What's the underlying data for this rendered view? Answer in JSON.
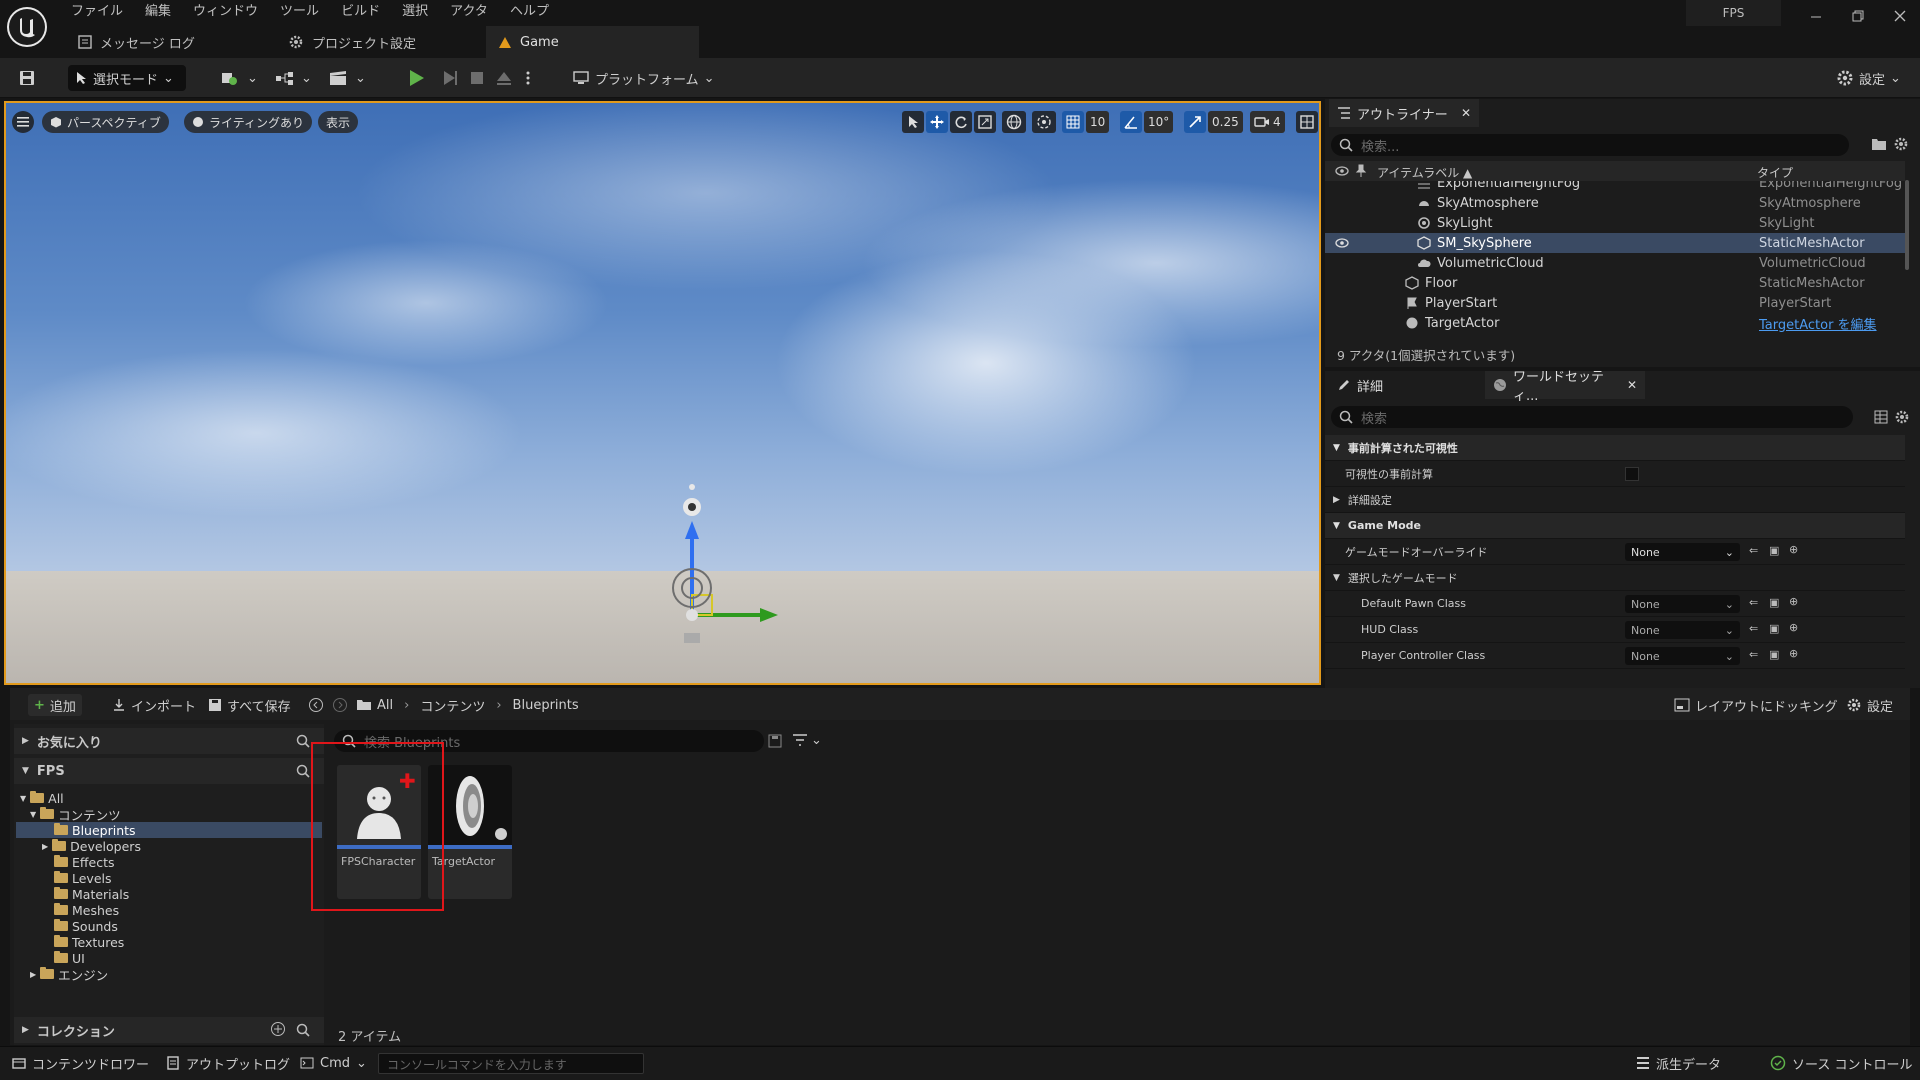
{
  "menu": [
    "ファイル",
    "編集",
    "ウィンドウ",
    "ツール",
    "ビルド",
    "選択",
    "アクタ",
    "ヘルプ"
  ],
  "window": {
    "fps_label": "FPS"
  },
  "tabs": [
    {
      "label": "メッセージ ログ",
      "icon": "message-log-icon"
    },
    {
      "label": "プロジェクト設定",
      "icon": "gear-icon"
    },
    {
      "label": "Game",
      "icon": "level-icon"
    }
  ],
  "toolbar": {
    "select_mode": "選択モード",
    "platform": "プラットフォーム",
    "settings": "設定"
  },
  "viewport": {
    "perspective": "パースペクティブ",
    "lighting": "ライティングあり",
    "show": "表示",
    "grid_snap": "10",
    "rotation_snap": "10°",
    "scale_snap": "0.25",
    "camera_speed": "4"
  },
  "outliner": {
    "tab": "アウトライナー",
    "search_placeholder": "検索...",
    "col_label": "アイテムラベル ▲",
    "col_type": "タイプ",
    "rows": [
      {
        "label": "ExponentialHeightFog",
        "type": "ExponentialHeightFog"
      },
      {
        "label": "SkyAtmosphere",
        "type": "SkyAtmosphere"
      },
      {
        "label": "SkyLight",
        "type": "SkyLight"
      },
      {
        "label": "SM_SkySphere",
        "type": "StaticMeshActor"
      },
      {
        "label": "VolumetricCloud",
        "type": "VolumetricCloud"
      },
      {
        "label": "Floor",
        "type": "StaticMeshActor"
      },
      {
        "label": "PlayerStart",
        "type": "PlayerStart"
      },
      {
        "label": "TargetActor",
        "type": "TargetActor を編集"
      }
    ],
    "footer": "9 アクタ(1個選択されています)"
  },
  "details": {
    "tab_details": "詳細",
    "tab_world": "ワールドセッティ...",
    "search_placeholder": "検索",
    "cat_precomputed": "事前計算された可視性",
    "precompute_visibility": "可視性の事前計算",
    "advanced": "詳細設定",
    "cat_game_mode": "Game Mode",
    "game_mode_override": "ゲームモードオーバーライド",
    "override_value": "None",
    "selected_game_mode": "選択したゲームモード",
    "default_pawn": "Default Pawn Class",
    "hud_class": "HUD Class",
    "player_controller": "Player Controller Class",
    "none": "None"
  },
  "content_browser": {
    "add": "追加",
    "import": "インポート",
    "save_all": "すべて保存",
    "crumbs": [
      "All",
      "コンテンツ",
      "Blueprints"
    ],
    "dock": "レイアウトにドッキング",
    "settings": "設定",
    "favorites": "お気に入り",
    "fps_root": "FPS",
    "search_placeholder": "検索 Blueprints",
    "tree": [
      {
        "label": "All",
        "depth": 0
      },
      {
        "label": "コンテンツ",
        "depth": 1
      },
      {
        "label": "Blueprints",
        "depth": 2
      },
      {
        "label": "Developers",
        "depth": 2
      },
      {
        "label": "Effects",
        "depth": 2
      },
      {
        "label": "Levels",
        "depth": 2
      },
      {
        "label": "Materials",
        "depth": 2
      },
      {
        "label": "Meshes",
        "depth": 2
      },
      {
        "label": "Sounds",
        "depth": 2
      },
      {
        "label": "Textures",
        "depth": 2
      },
      {
        "label": "UI",
        "depth": 2
      },
      {
        "label": "エンジン",
        "depth": 1
      }
    ],
    "collections": "コレクション",
    "assets": [
      {
        "name": "FPSCharacter"
      },
      {
        "name": "TargetActor"
      }
    ],
    "item_count": "2 アイテム"
  },
  "statusbar": {
    "content_drawer": "コンテンツドロワー",
    "output_log": "アウトプットログ",
    "cmd": "Cmd",
    "console_placeholder": "コンソールコマンドを入力します",
    "derived_data": "派生データ",
    "source_control": "ソース コントロール"
  },
  "colors": {
    "accent_orange": "#e29a1c",
    "selected_row": "#3a4a63",
    "play_green": "#5fb34a",
    "highlight_red": "#e0161a"
  }
}
